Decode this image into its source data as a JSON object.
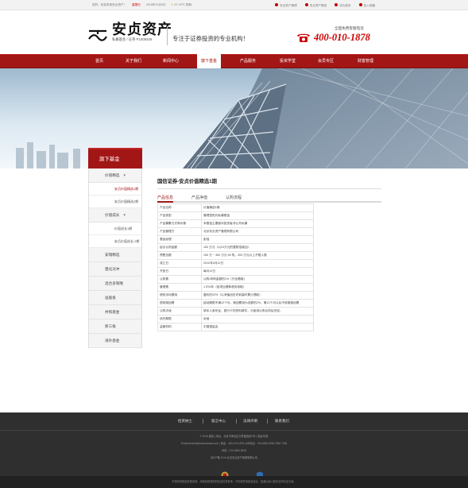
{
  "topbar": {
    "welcome": "您好，欢迎来到安贞资产！",
    "date": "2016年10月9日",
    "weekday": "星期日",
    "weather": "12~22℃ 阴转",
    "links": [
      "安贞资产微博",
      "安贞资产微信",
      "设为首页",
      "加入收藏"
    ]
  },
  "header": {
    "logo_text": "安贞资产",
    "logo_sub": "私募基金 / 证券 P1009349",
    "slogan": "专注于证券投资的专业机构！",
    "hotline_label": "全国免费客服电话",
    "hotline": "400-010-1878"
  },
  "nav": {
    "items": [
      {
        "label": "首页"
      },
      {
        "label": "关于我们"
      },
      {
        "label": "新闻中心"
      },
      {
        "label": "旗下基金"
      },
      {
        "label": "产品服务"
      },
      {
        "label": "投资学堂"
      },
      {
        "label": "会员专区"
      },
      {
        "label": "财富管理"
      }
    ]
  },
  "sidebar": {
    "title": "旗下基金",
    "groups": [
      {
        "label": "价值精选",
        "arrow": "▼"
      },
      {
        "label": "安贞价值精选1期"
      },
      {
        "label": "安贞价值精选2期"
      },
      {
        "label": "价值成长",
        "arrow": "▼"
      },
      {
        "label": "价值成长1期"
      },
      {
        "label": "安贞价值成长.2期"
      },
      {
        "label": "安瑞精选"
      },
      {
        "label": "量化对冲"
      },
      {
        "label": "混合多策略"
      },
      {
        "label": "准股投"
      },
      {
        "label": "并购基金"
      },
      {
        "label": "新三板"
      },
      {
        "label": "海外基金"
      }
    ]
  },
  "content": {
    "title": "国信证券-安贞价值精选1期",
    "tabs": [
      "产品信息",
      "产品净值",
      "认购流程"
    ],
    "rows": [
      {
        "k": "产品名称",
        "v": "价值精选1期"
      },
      {
        "k": "产品类型",
        "v": "管理型阳光私募基金"
      },
      {
        "k": "产品募集方式和对象",
        "v": "本基金主要面向投资者非公开私募"
      },
      {
        "k": "产品管理方",
        "v": "北京安贞资产管理有限公司"
      },
      {
        "k": "基金经理",
        "v": "彭强"
      },
      {
        "k": "起点认购金额",
        "v": "100 万元（以10万元的整数倍增加）"
      },
      {
        "k": "预售总额",
        "v": "100 万 ~ 300 万元 50 笔，300 万元以上不限人数"
      },
      {
        "k": "成立日",
        "v": "2012年4月11日"
      },
      {
        "k": "开放日",
        "v": "每月11日"
      },
      {
        "k": "认购费",
        "v": "认购/申购金额的1%（外含着取）"
      },
      {
        "k": "管理费",
        "v": "1.5%/年（依项目费和税务收取）"
      },
      {
        "k": "绩效浮动费用",
        "v": "盈利的20%（以净值创历史新高时累计提取）"
      },
      {
        "k": "提前赎回费",
        "v": "起动期限不满12个月，赎回费用为总额的2%，第12个月以后不收取赎回费"
      },
      {
        "k": "认购手续",
        "v": "填本人身份证、银行卡的资料原件，与使用认购合同后完成。"
      },
      {
        "k": "信托期限",
        "v": "永续"
      },
      {
        "k": "监管机构",
        "v": "中国银监会"
      }
    ]
  },
  "footer": {
    "links": [
      "招贤纳士",
      "留言中心",
      "法律声明",
      "联系我们"
    ],
    "info_lines": [
      "© 2016 版权 | 地址：北京市海淀区万寿路西街2号 | 电话/传真",
      "Email:service@anzhenasset.com | 电话：400-010-1878 公司电话：010-6851 8918 7660 7266",
      "传真：010-6851 8918",
      "京ICP备 2014  北京安贞资产管理有限公司"
    ],
    "badges": [
      "上海市工商行政管理局",
      "京公网安备 1101082015"
    ],
    "bottom": "市场有风险投资需谨慎，本网站所提供的信息仅供参考，不构成任何投资建议，如遇纠纷以相关合同约定为准。"
  }
}
